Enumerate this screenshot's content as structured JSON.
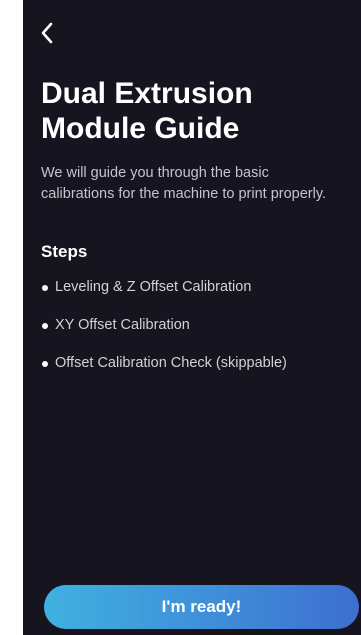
{
  "header": {
    "back_icon": "chevron-left-icon"
  },
  "title": {
    "line1": "Dual Extrusion",
    "line2": "Module Guide"
  },
  "intro": {
    "line1": "We will guide you through the basic",
    "line2": "calibrations for the machine to print properly."
  },
  "steps": {
    "heading": "Steps",
    "items": [
      {
        "label": "Leveling & Z Offset Calibration"
      },
      {
        "label": "XY Offset Calibration"
      },
      {
        "label": "Offset Calibration Check (skippable)"
      }
    ]
  },
  "footer": {
    "ready_label": "I'm ready!"
  },
  "colors": {
    "background": "#16151f",
    "text": "#ffffff",
    "muted_text": "#c4c3ce",
    "button_gradient_start": "#3fb1e0",
    "button_gradient_end": "#3d6fd0"
  }
}
